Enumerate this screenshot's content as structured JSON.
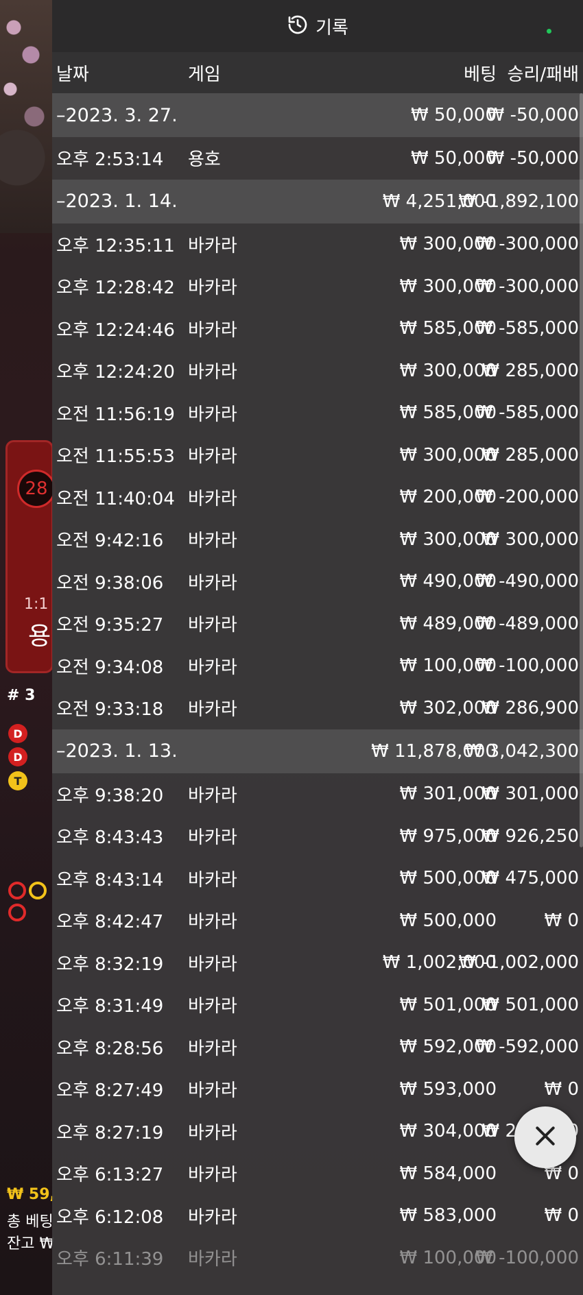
{
  "header": {
    "title": "기록",
    "icon": "history-icon",
    "status_color": "#21c75a"
  },
  "columns": {
    "date": "날짜",
    "game": "게임",
    "bet": "베팅",
    "result": "승리/패배"
  },
  "background": {
    "card_number": "28",
    "card_odds": "1:1",
    "card_label": "용",
    "round": "# 3",
    "chips": [
      "D",
      "D",
      "T"
    ],
    "balance_amount": "₩ 59,",
    "total_bet_label": "총 베팅",
    "balance_label": "잔고 ₩"
  },
  "groups": [
    {
      "date": "–2023. 3. 27.",
      "bet": "₩ 50,000",
      "result": "₩ -50,000",
      "rows": [
        {
          "time": "오후 2:53:14",
          "game": "용호",
          "bet": "₩ 50,000",
          "result": "₩ -50,000"
        }
      ]
    },
    {
      "date": "–2023. 1. 14.",
      "bet": "₩ 4,251,000",
      "result": "₩ -1,892,100",
      "rows": [
        {
          "time": "오후 12:35:11",
          "game": "바카라",
          "bet": "₩ 300,000",
          "result": "₩ -300,000"
        },
        {
          "time": "오후 12:28:42",
          "game": "바카라",
          "bet": "₩ 300,000",
          "result": "₩ -300,000"
        },
        {
          "time": "오후 12:24:46",
          "game": "바카라",
          "bet": "₩ 585,000",
          "result": "₩ -585,000"
        },
        {
          "time": "오후 12:24:20",
          "game": "바카라",
          "bet": "₩ 300,000",
          "result": "₩ 285,000"
        },
        {
          "time": "오전 11:56:19",
          "game": "바카라",
          "bet": "₩ 585,000",
          "result": "₩ -585,000"
        },
        {
          "time": "오전 11:55:53",
          "game": "바카라",
          "bet": "₩ 300,000",
          "result": "₩ 285,000"
        },
        {
          "time": "오전 11:40:04",
          "game": "바카라",
          "bet": "₩ 200,000",
          "result": "₩ -200,000"
        },
        {
          "time": "오전 9:42:16",
          "game": "바카라",
          "bet": "₩ 300,000",
          "result": "₩ 300,000"
        },
        {
          "time": "오전 9:38:06",
          "game": "바카라",
          "bet": "₩ 490,000",
          "result": "₩ -490,000"
        },
        {
          "time": "오전 9:35:27",
          "game": "바카라",
          "bet": "₩ 489,000",
          "result": "₩ -489,000"
        },
        {
          "time": "오전 9:34:08",
          "game": "바카라",
          "bet": "₩ 100,000",
          "result": "₩ -100,000"
        },
        {
          "time": "오전 9:33:18",
          "game": "바카라",
          "bet": "₩ 302,000",
          "result": "₩ 286,900"
        }
      ]
    },
    {
      "date": "–2023. 1. 13.",
      "bet": "₩ 11,878,000",
      "result": "₩ 3,042,300",
      "rows": [
        {
          "time": "오후 9:38:20",
          "game": "바카라",
          "bet": "₩ 301,000",
          "result": "₩ 301,000"
        },
        {
          "time": "오후 8:43:43",
          "game": "바카라",
          "bet": "₩ 975,000",
          "result": "₩ 926,250"
        },
        {
          "time": "오후 8:43:14",
          "game": "바카라",
          "bet": "₩ 500,000",
          "result": "₩ 475,000"
        },
        {
          "time": "오후 8:42:47",
          "game": "바카라",
          "bet": "₩ 500,000",
          "result": "₩ 0"
        },
        {
          "time": "오후 8:32:19",
          "game": "바카라",
          "bet": "₩ 1,002,000",
          "result": "₩ -1,002,000"
        },
        {
          "time": "오후 8:31:49",
          "game": "바카라",
          "bet": "₩ 501,000",
          "result": "₩ 501,000"
        },
        {
          "time": "오후 8:28:56",
          "game": "바카라",
          "bet": "₩ 592,000",
          "result": "₩ -592,000"
        },
        {
          "time": "오후 8:27:49",
          "game": "바카라",
          "bet": "₩ 593,000",
          "result": "₩ 0"
        },
        {
          "time": "오후 8:27:19",
          "game": "바카라",
          "bet": "₩ 304,000",
          "result": "₩ 288,800"
        },
        {
          "time": "오후 6:13:27",
          "game": "바카라",
          "bet": "₩ 584,000",
          "result": "₩ 0"
        },
        {
          "time": "오후 6:12:08",
          "game": "바카라",
          "bet": "₩ 583,000",
          "result": "₩ 0"
        },
        {
          "time": "오후 6:11:39",
          "game": "바카라",
          "bet": "₩ 100,000",
          "result": "₩ -100,000"
        }
      ]
    }
  ],
  "close_button": {
    "icon": "close-icon"
  }
}
